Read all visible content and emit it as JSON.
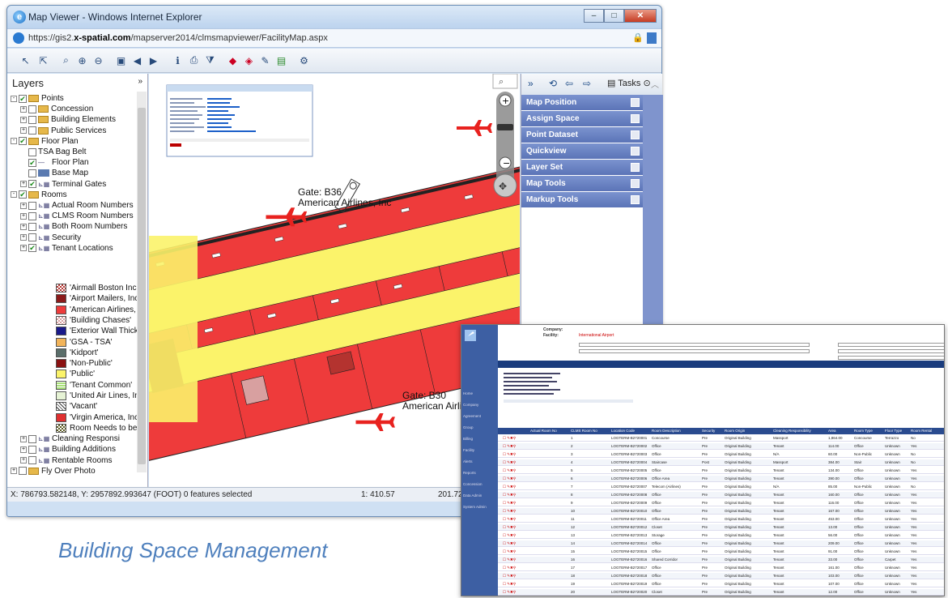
{
  "window": {
    "title": "Map Viewer - Windows Internet Explorer",
    "url_prefix": "https://gis2.",
    "url_domain": "x-spatial.com",
    "url_path": "/mapserver2014/clmsmapviewer/FacilityMap.aspx"
  },
  "layers": {
    "header": "Layers",
    "items": [
      {
        "label": "Points",
        "level": 0,
        "type": "folder",
        "checked": true,
        "exp": "-"
      },
      {
        "label": "Concession",
        "level": 1,
        "type": "folder",
        "checked": false,
        "exp": "+"
      },
      {
        "label": "Building Elements",
        "level": 1,
        "type": "folder",
        "checked": false,
        "exp": "+"
      },
      {
        "label": "Public Services",
        "level": 1,
        "type": "folder",
        "checked": false,
        "exp": "+"
      },
      {
        "label": "Floor Plan",
        "level": 0,
        "type": "folder",
        "checked": true,
        "exp": "-"
      },
      {
        "label": "TSA Bag Belt",
        "level": 1,
        "type": "layer",
        "checked": false,
        "exp": ""
      },
      {
        "label": "Floor Plan",
        "level": 1,
        "type": "line",
        "checked": true,
        "exp": ""
      },
      {
        "label": "Base Map",
        "level": 1,
        "type": "img",
        "checked": false,
        "exp": ""
      },
      {
        "label": "Terminal Gates",
        "level": 1,
        "type": "group",
        "checked": true,
        "exp": "+"
      },
      {
        "label": "Rooms",
        "level": 0,
        "type": "folder",
        "checked": true,
        "exp": "-"
      },
      {
        "label": "Actual Room Numbers",
        "level": 1,
        "type": "group",
        "checked": false,
        "exp": "+"
      },
      {
        "label": "CLMS Room Numbers",
        "level": 1,
        "type": "group",
        "checked": false,
        "exp": "+"
      },
      {
        "label": "Both Room Numbers",
        "level": 1,
        "type": "group",
        "checked": false,
        "exp": "+"
      },
      {
        "label": "Security",
        "level": 1,
        "type": "group",
        "checked": false,
        "exp": "+"
      },
      {
        "label": "Tenant Locations",
        "level": 1,
        "type": "group",
        "checked": true,
        "exp": "+"
      }
    ],
    "legend": [
      {
        "label": "'Airmall Boston Inc.'",
        "color": "#b4332f",
        "pattern": "check"
      },
      {
        "label": "'Airport Mailers, Inc.'",
        "color": "#8b1a1a",
        "pattern": ""
      },
      {
        "label": "'American Airlines, Inc",
        "color": "#ee3b3b",
        "pattern": ""
      },
      {
        "label": "'Building Chases'",
        "color": "#d8a0a0",
        "pattern": "check"
      },
      {
        "label": "'Exterior Wall Thickner",
        "color": "#1a1a8a",
        "pattern": ""
      },
      {
        "label": "'GSA - TSA'",
        "color": "#f2b45a",
        "pattern": ""
      },
      {
        "label": "'Kidport'",
        "color": "#5a6e6a",
        "pattern": ""
      },
      {
        "label": "'Non-Public'",
        "color": "#8a1212",
        "pattern": ""
      },
      {
        "label": "'Public'",
        "color": "#fbf36a",
        "pattern": ""
      },
      {
        "label": "'Tenant Common'",
        "color": "#a9e07a",
        "pattern": "grid"
      },
      {
        "label": "'United Air Lines, Inc.'",
        "color": "#e6f3d5",
        "pattern": ""
      },
      {
        "label": "'Vacant'",
        "color": "#ffffff",
        "pattern": "hatch"
      },
      {
        "label": "'Virgin America, Inc.'",
        "color": "#e03030",
        "pattern": ""
      },
      {
        "label": "Room Needs to be Co",
        "color": "#5a5a20",
        "pattern": "check"
      }
    ],
    "bottom": [
      {
        "label": "Cleaning Responsi",
        "level": 1,
        "type": "group",
        "checked": false,
        "exp": "+"
      },
      {
        "label": "Building Additions",
        "level": 1,
        "type": "group",
        "checked": false,
        "exp": "+"
      },
      {
        "label": "Rentable Rooms",
        "level": 1,
        "type": "group",
        "checked": false,
        "exp": "+"
      },
      {
        "label": "Fly Over Photo",
        "level": 0,
        "type": "folder",
        "checked": false,
        "exp": "+"
      }
    ]
  },
  "map": {
    "gate_b36": "Gate: B36",
    "airline_b36": "American Airlines, Inc",
    "gate_b30": "Gate: B30",
    "airline_b30": "American Airlin"
  },
  "tasks": {
    "label": "Tasks",
    "items": [
      "Map Position",
      "Assign Space",
      "Point Dataset",
      "Quickview",
      "Layer Set",
      "Map Tools",
      "Markup Tools"
    ]
  },
  "status": {
    "coords": "X: 786793.582148, Y: 2957892.993647 (FOOT) 0 features selected",
    "scale": "1: 410.57",
    "extra": "201.72"
  },
  "caption": "Building Space Management",
  "inset": {
    "company_label": "Company:",
    "facility_label": "Facility:",
    "facility_value": "International Airport",
    "nav": [
      "Home",
      "Company",
      "Agreement",
      "Group",
      "Billing",
      "Facility",
      "Alerts",
      "Reports",
      "Concession",
      "Data Admin",
      "System Admin"
    ],
    "columns": [
      "Actual Room No",
      "CLMS Room No",
      "Location Code",
      "Room Description",
      "Security",
      "Room Origin",
      "Cleaning Responsibility",
      "Area",
      "Room Type",
      "Floor Type",
      "Room Rental"
    ],
    "rows": [
      [
        "",
        "1",
        "LOGTERM-B2720001",
        "Concourse",
        "Pre",
        "Original Building",
        "Massport",
        "1,864.00",
        "Concourse",
        "Terrazzo",
        "No"
      ],
      [
        "",
        "2",
        "LOGTERM-B2720002",
        "Office",
        "Pre",
        "Original Building",
        "Tenant",
        "114.00",
        "Office",
        "Unknown",
        "Yes"
      ],
      [
        "",
        "3",
        "LOGTERM-B2720003",
        "Office",
        "Pre",
        "Original Building",
        "N/A",
        "60.00",
        "Non-Public",
        "Unknown",
        "No"
      ],
      [
        "",
        "4",
        "LOGTERM-B2720004",
        "Staircase",
        "Post",
        "Original Building",
        "Massport",
        "384.00",
        "Stair",
        "Unknown",
        "No"
      ],
      [
        "",
        "5",
        "LOGTERM-B2720005",
        "Office",
        "Pre",
        "Original Building",
        "Tenant",
        "134.00",
        "Office",
        "Unknown",
        "Yes"
      ],
      [
        "",
        "6",
        "LOGTERM-B2720006",
        "Office Area",
        "Pre",
        "Original Building",
        "Tenant",
        "390.00",
        "Office",
        "Unknown",
        "Yes"
      ],
      [
        "",
        "7",
        "LOGTERM-B2720007",
        "Telecom (Airlines)",
        "Pre",
        "Original Building",
        "N/A",
        "85.00",
        "Non-Public",
        "Unknown",
        "No"
      ],
      [
        "",
        "8",
        "LOGTERM-B2720008",
        "Office",
        "Pre",
        "Original Building",
        "Tenant",
        "160.00",
        "Office",
        "Unknown",
        "Yes"
      ],
      [
        "",
        "9",
        "LOGTERM-B2720009",
        "Office",
        "Pre",
        "Original Building",
        "Tenant",
        "116.00",
        "Office",
        "Unknown",
        "Yes"
      ],
      [
        "",
        "10",
        "LOGTERM-B2720010",
        "Office",
        "Pre",
        "Original Building",
        "Tenant",
        "167.00",
        "Office",
        "Unknown",
        "Yes"
      ],
      [
        "",
        "11",
        "LOGTERM-B2720011",
        "Office Area",
        "Pre",
        "Original Building",
        "Tenant",
        "453.00",
        "Office",
        "Unknown",
        "Yes"
      ],
      [
        "",
        "12",
        "LOGTERM-B2720012",
        "Closet",
        "Pre",
        "Original Building",
        "Tenant",
        "13.00",
        "Office",
        "Unknown",
        "Yes"
      ],
      [
        "",
        "13",
        "LOGTERM-B2720013",
        "Storage",
        "Pre",
        "Original Building",
        "Tenant",
        "56.00",
        "Office",
        "Unknown",
        "Yes"
      ],
      [
        "",
        "14",
        "LOGTERM-B2720014",
        "Office",
        "Pre",
        "Original Building",
        "Tenant",
        "209.00",
        "Office",
        "Unknown",
        "Yes"
      ],
      [
        "",
        "15",
        "LOGTERM-B2720015",
        "Office",
        "Pre",
        "Original Building",
        "Tenant",
        "91.00",
        "Office",
        "Unknown",
        "Yes"
      ],
      [
        "",
        "16",
        "LOGTERM-B2720016",
        "Shared Corridor",
        "Pre",
        "Original Building",
        "Tenant",
        "33.00",
        "Office",
        "Carpet",
        "Yes"
      ],
      [
        "",
        "17",
        "LOGTERM-B2720017",
        "Office",
        "Pre",
        "Original Building",
        "Tenant",
        "161.00",
        "Office",
        "Unknown",
        "Yes"
      ],
      [
        "",
        "18",
        "LOGTERM-B2720018",
        "Office",
        "Pre",
        "Original Building",
        "Tenant",
        "103.00",
        "Office",
        "Unknown",
        "Yes"
      ],
      [
        "",
        "19",
        "LOGTERM-B2720019",
        "Office",
        "Pre",
        "Original Building",
        "Tenant",
        "107.00",
        "Office",
        "Unknown",
        "Yes"
      ],
      [
        "",
        "20",
        "LOGTERM-B2720020",
        "Closet",
        "Pre",
        "Original Building",
        "Tenant",
        "12.00",
        "Office",
        "Unknown",
        "Yes"
      ]
    ]
  }
}
